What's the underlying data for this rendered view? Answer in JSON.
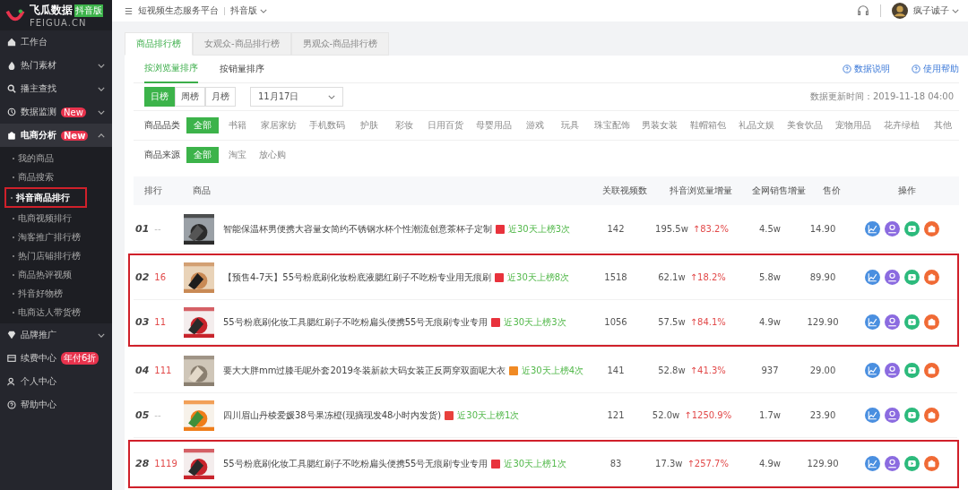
{
  "logo": {
    "name": "飞瓜数据",
    "badge": "抖音版",
    "domain": "FEIGUA.CN"
  },
  "sidebar": {
    "items": [
      {
        "label": "工作台"
      },
      {
        "label": "热门素材",
        "expanded": false
      },
      {
        "label": "播主查找",
        "expanded": false
      },
      {
        "label": "数据监测",
        "badge": "New",
        "expanded": false
      },
      {
        "label": "电商分析",
        "badge": "New",
        "expanded": true,
        "children": [
          {
            "label": "我的商品",
            "selected": false,
            "highlighted": false
          },
          {
            "label": "商品搜索",
            "selected": false,
            "highlighted": false
          },
          {
            "label": "抖音商品排行",
            "selected": true,
            "highlighted": true
          },
          {
            "label": "电商视频排行",
            "selected": false,
            "highlighted": false
          },
          {
            "label": "淘客推广排行榜",
            "selected": false,
            "highlighted": false
          },
          {
            "label": "热门店铺排行榜",
            "selected": false,
            "highlighted": false
          },
          {
            "label": "商品热评视频",
            "selected": false,
            "highlighted": false
          },
          {
            "label": "抖音好物榜",
            "selected": false,
            "highlighted": false
          },
          {
            "label": "电商达人带货榜",
            "selected": false,
            "highlighted": false
          }
        ]
      },
      {
        "label": "品牌推广",
        "expanded": false
      },
      {
        "label": "续费中心",
        "badge": "年付6折"
      },
      {
        "label": "个人中心"
      },
      {
        "label": "帮助中心"
      }
    ]
  },
  "header": {
    "menu": "☰",
    "platform": "短视频生态服务平台",
    "edition": "抖音版",
    "user": "疯子诚子"
  },
  "tabs": [
    {
      "label": "商品排行榜",
      "selected": true
    },
    {
      "label": "女观众-商品排行榜",
      "selected": false
    },
    {
      "label": "男观众-商品排行榜",
      "selected": false
    }
  ],
  "subtabs": [
    {
      "label": "按浏览量排序",
      "selected": true
    },
    {
      "label": "按销量排序",
      "selected": false
    }
  ],
  "help_links": [
    "数据说明",
    "使用帮助"
  ],
  "periods": [
    {
      "label": "日榜",
      "selected": true
    },
    {
      "label": "周榜",
      "selected": false
    },
    {
      "label": "月榜",
      "selected": false
    }
  ],
  "date": "11月17日",
  "updated": "数据更新时间：2019-11-18 04:00",
  "filters": [
    {
      "label": "商品品类",
      "options": [
        {
          "label": "全部",
          "selected": true
        },
        {
          "label": "书籍",
          "selected": false
        },
        {
          "label": "家居家纺",
          "selected": false
        },
        {
          "label": "手机数码",
          "selected": false
        },
        {
          "label": "护肤",
          "selected": false
        },
        {
          "label": "彩妆",
          "selected": false
        },
        {
          "label": "日用百货",
          "selected": false
        },
        {
          "label": "母婴用品",
          "selected": false
        },
        {
          "label": "游戏",
          "selected": false
        },
        {
          "label": "玩具",
          "selected": false
        },
        {
          "label": "珠宝配饰",
          "selected": false
        },
        {
          "label": "男装女装",
          "selected": false
        },
        {
          "label": "鞋帽箱包",
          "selected": false
        },
        {
          "label": "礼品文娱",
          "selected": false
        },
        {
          "label": "美食饮品",
          "selected": false
        },
        {
          "label": "宠物用品",
          "selected": false
        },
        {
          "label": "花卉绿植",
          "selected": false
        },
        {
          "label": "其他",
          "selected": false
        }
      ]
    },
    {
      "label": "商品来源",
      "options": [
        {
          "label": "全部",
          "selected": true
        },
        {
          "label": "淘宝",
          "selected": false
        },
        {
          "label": "放心购",
          "selected": false
        }
      ]
    }
  ],
  "table": {
    "columns": [
      "排行",
      "商品",
      "关联视频数",
      "抖音浏览量增量",
      "全网销售增量",
      "售价",
      "操作"
    ],
    "groups": [
      {
        "highlighted": false,
        "rows": [
          {
            "rank": "01",
            "change": "--",
            "rising": false,
            "title": "智能保温杯男便携大容量女简约不锈钢水杯个性潮流创意茶杯子定制",
            "color": "#e8323c",
            "times": "近30天上榜3次",
            "videos": "142",
            "views": "195.5w",
            "growth": "↑83.2%",
            "sales": "4.5w",
            "price": "14.90"
          }
        ]
      },
      {
        "highlighted": true,
        "rows": [
          {
            "rank": "02",
            "change": "16",
            "rising": true,
            "title": "【预售4-7天】55号粉底刷化妆粉底液腮红刷子不吃粉专业用无痕刷",
            "color": "#e8323c",
            "times": "近30天上榜8次",
            "videos": "1518",
            "views": "62.1w",
            "growth": "↑18.2%",
            "sales": "5.8w",
            "price": "89.90"
          },
          {
            "rank": "03",
            "change": "11",
            "rising": true,
            "title": "55号粉底刷化妆工具腮红刷子不吃粉扁头便携55号无痕刷专业专用",
            "color": "#e8323c",
            "times": "近30天上榜3次",
            "videos": "1056",
            "views": "57.5w",
            "growth": "↑84.1%",
            "sales": "4.9w",
            "price": "129.90"
          }
        ]
      },
      {
        "highlighted": false,
        "rows": [
          {
            "rank": "04",
            "change": "111",
            "rising": true,
            "title": "要大大胖mm过膝毛呢外套2019冬装新款大码女装正反两穿双面呢大衣",
            "color": "#f08a24",
            "times": "近30天上榜4次",
            "videos": "141",
            "views": "52.8w",
            "growth": "↑41.3%",
            "sales": "937",
            "price": "29.00"
          },
          {
            "rank": "05",
            "change": "--",
            "rising": false,
            "title": "四川眉山丹棱爱媛38号果冻橙(现摘现发48小时内发货)",
            "color": "#e8403c",
            "times": "近30天上榜1次",
            "videos": "121",
            "views": "52.0w",
            "growth": "↑1250.9%",
            "sales": "1.7w",
            "price": "23.90"
          }
        ]
      },
      {
        "highlighted": true,
        "rows": [
          {
            "rank": "28",
            "change": "1119",
            "rising": true,
            "title": "55号粉底刷化妆工具腮红刷子不吃粉扁头便携55号无痕刷专业专用",
            "color": "#e8323c",
            "times": "近30天上榜1次",
            "videos": "83",
            "views": "17.3w",
            "growth": "↑257.7%",
            "sales": "4.9w",
            "price": "129.90"
          }
        ]
      }
    ]
  }
}
